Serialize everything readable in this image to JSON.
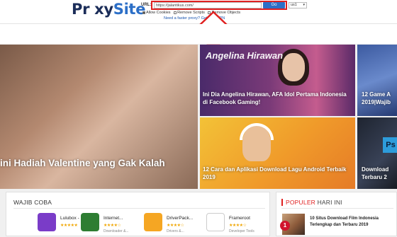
{
  "proxy": {
    "logo_main": "Pr xy",
    "logo_site": "Site",
    "logo_com": ".com",
    "url_label": "URL:",
    "url_value": "https://jalantikus.com/",
    "go_label": "Go",
    "server_value": "us1",
    "options": [
      {
        "label": "Allow Cookies",
        "checked": true
      },
      {
        "label": "Remove Scripts",
        "checked": false
      },
      {
        "label": "Remove Objects",
        "checked": false
      }
    ],
    "vpn_link": "Need a faster proxy? Get NordVPN"
  },
  "featured": {
    "main": {
      "caption": "ini Hadiah Valentine yang Gak Kalah"
    },
    "a": {
      "header": "Angelina Hirawan",
      "caption": "Ini Dia Angelina Hirawan, AFA Idol Pertama Indonesia di Facebook Gaming!"
    },
    "b": {
      "caption": "12 Game A 2019|Wajib"
    },
    "c": {
      "caption": "12 Cara dan Aplikasi Download Lagu Android Terbaik 2019"
    },
    "d": {
      "caption": "Download Terbaru 2"
    }
  },
  "wajib": {
    "title": "WAJIB COBA",
    "apps": [
      {
        "name": "Lulubox - Mo...",
        "stars": "★★★★★",
        "category": "",
        "color": "#7a3cc8"
      },
      {
        "name": "Internet...",
        "stars": "★★★★☆",
        "category": "Downloader &...",
        "color": "#2e7d32"
      },
      {
        "name": "DriverPack...",
        "stars": "★★★★☆",
        "category": "Drivers &...",
        "color": "#f5a623"
      },
      {
        "name": "Frameroot",
        "stars": "★★★★☆",
        "category": "Developer Tools",
        "color": "#ffffff"
      }
    ]
  },
  "populer": {
    "title_red": "POPULER",
    "title_rest": " HARI INI",
    "item_number": "1",
    "item_text": "10 Situs Download Film Indonesia Terlengkap dan Terbaru 2019"
  },
  "colors": {
    "accent_red": "#e02020",
    "proxy_blue": "#2c6fc7",
    "star": "#f0a500"
  }
}
